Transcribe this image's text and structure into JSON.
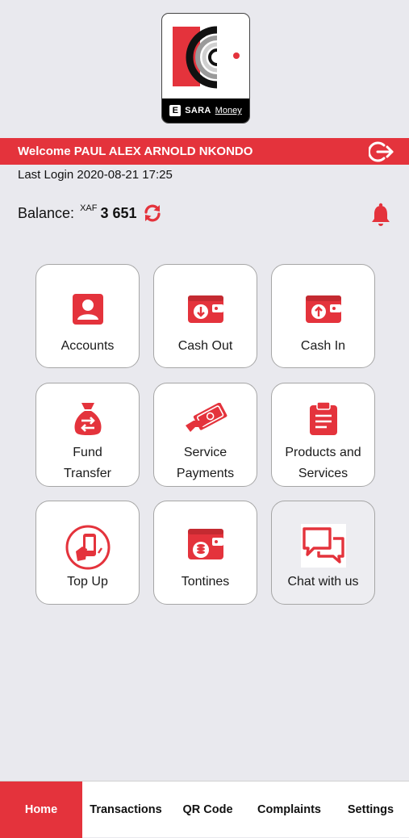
{
  "brand": {
    "name_bold": "SARA",
    "name_light": "Money",
    "mark": "E"
  },
  "header": {
    "welcome": "Welcome PAUL ALEX ARNOLD NKONDO",
    "last_login": "Last Login 2020-08-21  17:25"
  },
  "balance": {
    "label": "Balance:",
    "currency": "XAF",
    "amount": "3 651"
  },
  "tiles": [
    {
      "label": "Accounts",
      "icon": "account-card-icon"
    },
    {
      "label": "Cash Out",
      "icon": "wallet-down-icon"
    },
    {
      "label": "Cash In",
      "icon": "wallet-up-icon"
    },
    {
      "label": "Fund Transfer",
      "line1": "Fund",
      "line2": "Transfer",
      "icon": "money-bag-transfer-icon"
    },
    {
      "label": "Service Payments",
      "line1": "Service",
      "line2": "Payments",
      "icon": "hand-cash-icon"
    },
    {
      "label": "Products and Services",
      "line1": "Products and",
      "line2": "Services",
      "icon": "clipboard-icon"
    },
    {
      "label": "Top Up",
      "icon": "phone-topup-icon"
    },
    {
      "label": "Tontines",
      "icon": "wallet-coins-icon"
    },
    {
      "label": "Chat with us",
      "icon": "chat-bubbles-icon"
    }
  ],
  "nav": {
    "items": [
      "Home",
      "Transactions",
      "QR Code",
      "Complaints",
      "Settings"
    ],
    "active": "Home"
  },
  "colors": {
    "accent": "#e4333c",
    "background": "#e9e9ee",
    "tile": "#ffffff"
  }
}
